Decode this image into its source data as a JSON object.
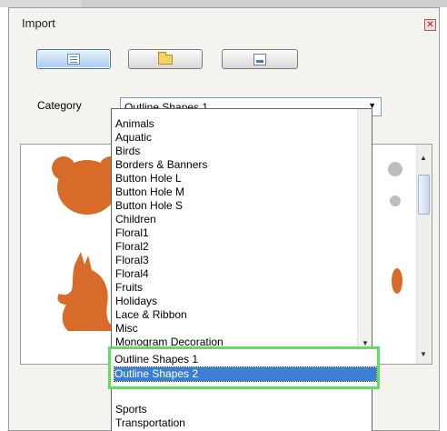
{
  "window": {
    "title": "Import",
    "close_glyph": "✕"
  },
  "toolbar": [
    {
      "icon": "list-view-icon"
    },
    {
      "icon": "folder-icon"
    },
    {
      "icon": "picture-icon"
    }
  ],
  "category": {
    "label": "Category",
    "selected": "Outline Shapes 1",
    "arrow": "▼"
  },
  "dropdown": {
    "items": [
      "Animals",
      "Aquatic",
      "Birds",
      "Borders & Banners",
      "Button Hole L",
      "Button Hole M",
      "Button Hole S",
      "Children",
      "Floral1",
      "Floral2",
      "Floral3",
      "Floral4",
      "Fruits",
      "Holidays",
      "Lace & Ribbon",
      "Misc",
      "Monogram Decoration"
    ],
    "highlighted": [
      "Outline Shapes 1",
      "Outline Shapes 2"
    ],
    "selected_index": 1,
    "after": [
      "Sports",
      "Transportation"
    ]
  },
  "preview": {
    "shapes": [
      {
        "name": "bear-outline-shape"
      },
      {
        "name": "kangaroo-outline-shape"
      }
    ],
    "shape_color": "#d86a2a"
  },
  "colors": {
    "highlight_border": "#5ee05e",
    "selection": "#3a7fd0"
  }
}
